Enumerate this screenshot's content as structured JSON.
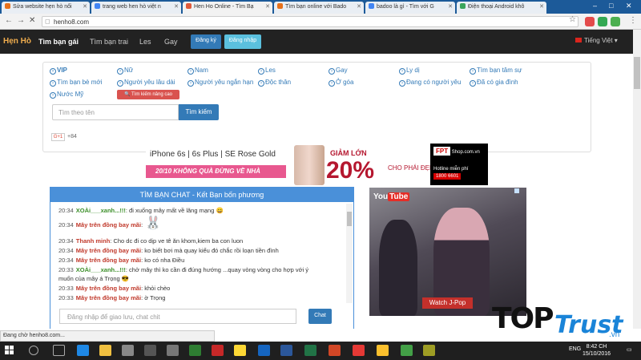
{
  "browser": {
    "tabs": [
      {
        "label": "Sửa website hẹn hò nổi"
      },
      {
        "label": "trang web hen hò việt n"
      },
      {
        "label": "Hen Ho Online - Tìm Bạ"
      },
      {
        "label": "Tìm bạn online với Bado"
      },
      {
        "label": "badoo là gì - Tìm với G"
      },
      {
        "label": "Điện thoại Android khô"
      }
    ],
    "url": "henho8.com",
    "status_text": "Đang chờ henho8.com..."
  },
  "site": {
    "brand": "Hẹn Hò",
    "nav": [
      "Tìm bạn gái",
      "Tìm bạn trai",
      "Les",
      "Gay"
    ],
    "register_label": "Đăng ký",
    "login_label": "Đăng nhập",
    "language": "Tiếng Việt",
    "filters": {
      "row1": [
        "VIP",
        "Nữ",
        "Nam",
        "Les",
        "Gay",
        "Ly dị",
        "Tìm bạn tâm sự"
      ],
      "row2": [
        "Tìm bạn bè mới",
        "Người yêu lâu dài",
        "Người yêu ngắn hạn",
        "Độc thân",
        "Ở góa",
        "Đang có người yêu",
        "Đã có gia đình"
      ],
      "row3": [
        "Nước Mỹ"
      ]
    },
    "advanced_search_label": "Tìm kiếm nâng cao",
    "search_placeholder": "Tìm theo tên",
    "search_button": "Tìm kiếm",
    "gplus_label": "G+1",
    "gplus_count": "+84"
  },
  "banner": {
    "headline": "iPhone 6s | 6s Plus | SE Rose Gold",
    "stripe": "20/10 KHÔNG QUÀ ĐỪNG VỀ NHÀ",
    "discount_label": "GIẢM LỚN",
    "discount_value": "20%",
    "discount_suffix": "CHO PHÁI ĐẸP",
    "shop_logo": "FPT",
    "shop_domain": "Shop.com.vn",
    "hotline_label": "Hotline miễn phí",
    "hotline_number": "1800 6601"
  },
  "chat": {
    "title": "TÌM BẠN CHAT - Kết Bạn bốn phương",
    "messages": [
      {
        "time": "20:34",
        "user": "XOÀi___xanh...!!!",
        "text": ": đi xuống mây mất về lăng mạng"
      },
      {
        "time": "20:34",
        "user": "Mây trên đồng bay mãi",
        "text": ":"
      },
      {
        "time": "20:34",
        "user": "Thanh minh",
        "text": ": Cho dc đi co dịp ve tê ăn khom,kiem ba con luon"
      },
      {
        "time": "20:34",
        "user": "Mây trên đồng bay mãi",
        "text": ": ko biết bơi mà quay kiểu đó chắc rồi loạn tiền đình"
      },
      {
        "time": "20:34",
        "user": "Mây trên đồng bay mãi",
        "text": ": ko có nha Điều"
      },
      {
        "time": "20:33",
        "user": "XOÀi___xanh...!!!",
        "text": ": chở mây thì ko cần đi đúng hướng ...quay vòng vòng cho hợp với ý"
      },
      {
        "time": "",
        "user": "",
        "text": "muốn của mây á Trọng"
      },
      {
        "time": "20:33",
        "user": "Mây trên đồng bay mãi",
        "text": ": khỏi chèo"
      },
      {
        "time": "20:33",
        "user": "Mây trên đồng bay mãi",
        "text": ": ờ Trọng"
      }
    ],
    "input_placeholder": "Đăng nhập để giao lưu, chat chit",
    "send_button": "Chat"
  },
  "video_ad": {
    "logo_you": "You",
    "logo_tube": "Tube",
    "watch_label": "Watch J-Pop"
  },
  "watermark": {
    "top": "TOP",
    "trust": "Trust",
    "vn": ".vn"
  },
  "taskbar": {
    "lang": "ENG",
    "time": "8:42 CH",
    "date": "15/10/2016"
  }
}
